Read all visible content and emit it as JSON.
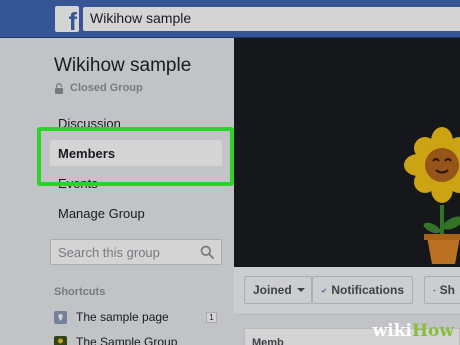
{
  "topbar": {
    "logo": "f",
    "search_value": "Wikihow sample"
  },
  "group": {
    "name": "Wikihow sample",
    "privacy": "Closed Group"
  },
  "nav": {
    "discussion": "Discussion",
    "members": "Members",
    "events": "Events",
    "manage": "Manage Group"
  },
  "group_search": {
    "placeholder": "Search this group"
  },
  "shortcuts": {
    "heading": "Shortcuts",
    "items": [
      {
        "label": "The sample page",
        "badge": "1"
      },
      {
        "label": "The Sample Group"
      }
    ]
  },
  "actions": {
    "joined": "Joined",
    "notifications": "Notifications",
    "share": "Sh"
  },
  "content": {
    "tab_label": "Memb"
  },
  "watermark": {
    "part1": "wiki",
    "part2": "How"
  },
  "colors": {
    "brand": "#4267b2",
    "highlight": "#29d429",
    "cover": "#1b1c20",
    "flower_petals": "#f5c518",
    "pot": "#e08a2a"
  },
  "icons": [
    "facebook-logo",
    "lock-icon",
    "search-icon",
    "pin-icon",
    "check-icon",
    "caret-down-icon",
    "share-icon"
  ]
}
